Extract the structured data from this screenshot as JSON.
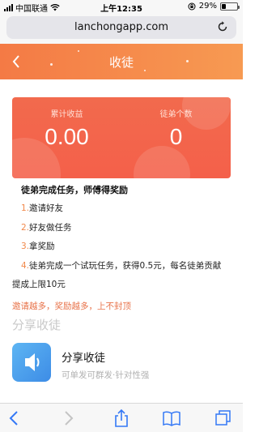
{
  "status_bar": {
    "carrier": "中国联通",
    "time": "上午12:35",
    "battery": "29%",
    "battery_level": 0.29
  },
  "browser": {
    "url": "lanchongapp.com"
  },
  "header": {
    "title": "收徒"
  },
  "card": {
    "earnings_label": "累计收益",
    "earnings_value": "0.00",
    "apprentice_label": "徒弟个数",
    "apprentice_value": "0"
  },
  "tasks": {
    "title": "徒弟完成任务，师傅得奖励",
    "items": [
      {
        "num": "1.",
        "text": "邀请好友"
      },
      {
        "num": "2.",
        "text": "好友做任务"
      },
      {
        "num": "3.",
        "text": "拿奖励"
      },
      {
        "num": "4.",
        "text": "徒弟完成一个试玩任务，获得0.5元，每名徒弟贡献"
      }
    ],
    "item4_wrap": "提成上限10元",
    "slogan": "邀请越多，奖励越多，上不封顶"
  },
  "share": {
    "heading": "分享收徒",
    "title": "分享收徒",
    "subtitle": "可单发可群发·针对性强"
  },
  "icons": {
    "signal": "signal-icon",
    "wifi": "wifi-icon",
    "orientation_lock": "orientation-lock-icon",
    "reload": "reload-icon",
    "back": "chevron-left-icon",
    "speaker": "speaker-icon",
    "forward": "chevron-right-icon",
    "share": "share-icon",
    "bookmarks": "book-icon",
    "tabs": "tabs-icon"
  },
  "colors": {
    "header": "#f47a45",
    "card": "#f26a4d",
    "accent": "#e8734a",
    "share_icon": "#4a9cec"
  }
}
